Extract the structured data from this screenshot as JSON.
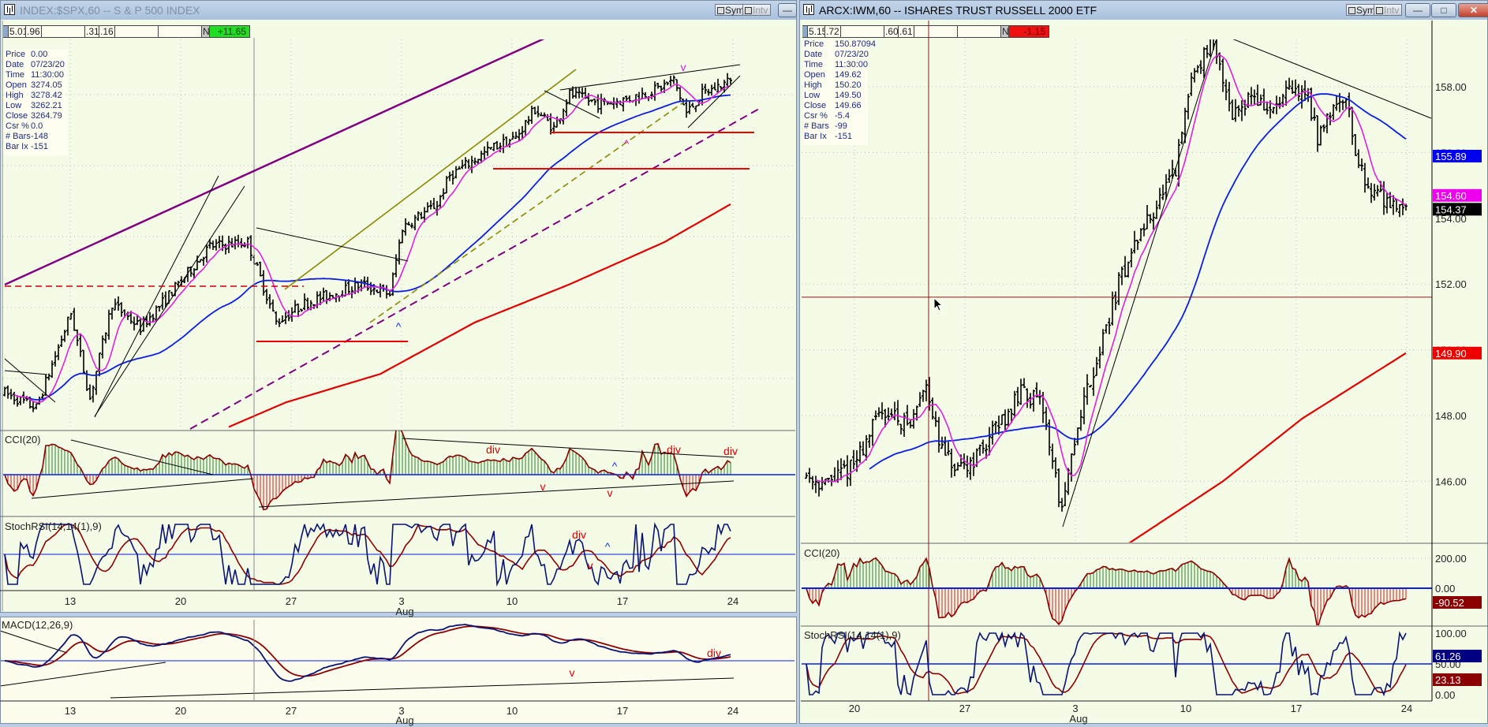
{
  "left_window": {
    "title": "INDEX:$SPX,60 -- S & P 500 INDEX",
    "sym_label": "Sym",
    "intv_label": "Intv",
    "minimize_glyph": "—",
    "header_cells": [
      "5.01",
      ".96",
      "",
      ".31",
      ".16",
      "",
      "",
      "N",
      "+11.65"
    ],
    "change_color": "#22dd22",
    "info": [
      {
        "label": "Price",
        "value": "0.00"
      },
      {
        "label": "Date",
        "value": "07/23/20"
      },
      {
        "label": "Time",
        "value": "11:30:00"
      },
      {
        "label": "Open",
        "value": "3274.05"
      },
      {
        "label": "High",
        "value": "3278.42"
      },
      {
        "label": "Low",
        "value": "3262.21"
      },
      {
        "label": "Close",
        "value": "3264.79"
      },
      {
        "label": "Csr %",
        "value": "0.0"
      },
      {
        "label": "# Bars",
        "value": "-148"
      },
      {
        "label": "Bar Ix",
        "value": "-151"
      }
    ],
    "cci_label": "CCI(20)",
    "stoch_label": "StochRSI(14,14(1),9)",
    "macd_label": "MACD(12,26,9)",
    "date_ticks": [
      "13",
      "20",
      "27",
      "3",
      "10",
      "17",
      "24"
    ],
    "month_label": "Aug",
    "annotations": {
      "price": [
        {
          "text": "v",
          "color": "#e020e0"
        },
        {
          "text": "^",
          "color": "#e020e0"
        },
        {
          "text": "^",
          "color": "#1030e0"
        }
      ],
      "cci": [
        {
          "text": "div",
          "color": "#e00000"
        },
        {
          "text": "div",
          "color": "#e00000"
        },
        {
          "text": "div",
          "color": "#e00000"
        },
        {
          "text": "v",
          "color": "#e00000"
        },
        {
          "text": "v",
          "color": "#e00000"
        },
        {
          "text": "^",
          "color": "#1030e0"
        }
      ],
      "stoch": [
        {
          "text": "div",
          "color": "#e00000"
        },
        {
          "text": "v",
          "color": "#e00000"
        },
        {
          "text": "^",
          "color": "#1030e0"
        }
      ],
      "macd": [
        {
          "text": "v",
          "color": "#e00000"
        },
        {
          "text": "div",
          "color": "#e00000"
        }
      ]
    }
  },
  "right_window": {
    "title": "ARCX:IWM,60 -- ISHARES TRUST RUSSELL 2000 ETF",
    "sym_label": "Sym",
    "intv_label": "Intv",
    "minimize_glyph": "—",
    "maximize_glyph": "□",
    "close_glyph": "✕",
    "header_cells": [
      "5.15",
      ".72",
      "",
      ".60",
      ".61",
      "",
      "",
      "N",
      "-1.15"
    ],
    "change_color": "#ee1111",
    "info": [
      {
        "label": "Price",
        "value": "150.87094"
      },
      {
        "label": "Date",
        "value": "07/23/20"
      },
      {
        "label": "Time",
        "value": "11:30:00"
      },
      {
        "label": "Open",
        "value": "149.62"
      },
      {
        "label": "High",
        "value": "150.20"
      },
      {
        "label": "Low",
        "value": "149.50"
      },
      {
        "label": "Close",
        "value": "149.66"
      },
      {
        "label": "Csr %",
        "value": "-5.4"
      },
      {
        "label": "# Bars",
        "value": "-99"
      },
      {
        "label": "Bar Ix",
        "value": "-151"
      }
    ],
    "price_axis": [
      "158.00",
      "156.00",
      "154.00",
      "152.00",
      "150.00",
      "148.00",
      "146.00"
    ],
    "price_tags": [
      {
        "value": "155.89",
        "color": "#0000ee"
      },
      {
        "value": "154.60",
        "color": "#ee00ee"
      },
      {
        "value": "154.37",
        "color": "#000000"
      },
      {
        "value": "149.90",
        "color": "#ee0000"
      }
    ],
    "cci_label": "CCI(20)",
    "cci_axis": [
      "200.00",
      "0.00"
    ],
    "cci_tag": {
      "value": "-90.52",
      "color": "#8b0000"
    },
    "stoch_label": "StochRSI(14,14(1),9)",
    "stoch_axis": [
      "100.00",
      "50.00",
      "0.00"
    ],
    "stoch_tags": [
      {
        "value": "61.26",
        "color": "#000080"
      },
      {
        "value": "23.13",
        "color": "#8b0000"
      }
    ],
    "date_ticks": [
      "20",
      "27",
      "3",
      "10",
      "17",
      "24"
    ],
    "month_label": "Aug"
  },
  "chart_data": [
    {
      "type": "ohlc",
      "title": "INDEX:$SPX,60 -- S & P 500 INDEX",
      "x_unit": "hourly bar index",
      "ylim": [
        3150,
        3450
      ],
      "price_keypoints": [
        [
          0,
          3177
        ],
        [
          10,
          3166
        ],
        [
          21,
          3236
        ],
        [
          27,
          3173
        ],
        [
          34,
          3243
        ],
        [
          43,
          3225
        ],
        [
          55,
          3257
        ],
        [
          65,
          3285
        ],
        [
          77,
          3288
        ],
        [
          86,
          3229
        ],
        [
          95,
          3243
        ],
        [
          113,
          3257
        ],
        [
          122,
          3250
        ],
        [
          126,
          3299
        ],
        [
          137,
          3316
        ],
        [
          141,
          3337
        ],
        [
          155,
          3358
        ],
        [
          162,
          3365
        ],
        [
          168,
          3386
        ],
        [
          174,
          3372
        ],
        [
          179,
          3397
        ],
        [
          188,
          3390
        ],
        [
          197,
          3393
        ],
        [
          206,
          3400
        ],
        [
          212,
          3407
        ],
        [
          216,
          3383
        ],
        [
          221,
          3397
        ],
        [
          230,
          3407
        ]
      ],
      "ma_long_keypoints": [
        [
          71,
          3152
        ],
        [
          89,
          3170
        ],
        [
          119,
          3191
        ],
        [
          149,
          3229
        ],
        [
          179,
          3257
        ],
        [
          209,
          3288
        ],
        [
          230,
          3316
        ]
      ],
      "support_levels": [
        3226,
        3380,
        3407
      ],
      "resistance_dashed": 3261,
      "indicators": [
        "CCI(20)",
        "StochRSI(14,14(1),9)",
        "MACD(12,26,9)"
      ]
    },
    {
      "type": "ohlc",
      "title": "ARCX:IWM,60 -- ISHARES TRUST RUSSELL 2000 ETF",
      "x_unit": "hourly bar index",
      "ylim": [
        144.5,
        159.9
      ],
      "price_keypoints": [
        [
          0,
          146.2
        ],
        [
          6,
          145.9
        ],
        [
          15,
          146.5
        ],
        [
          24,
          148.2
        ],
        [
          33,
          147.7
        ],
        [
          38,
          149.1
        ],
        [
          42,
          147.1
        ],
        [
          48,
          146.2
        ],
        [
          54,
          146.8
        ],
        [
          63,
          148.0
        ],
        [
          69,
          148.8
        ],
        [
          75,
          148.2
        ],
        [
          81,
          145.05
        ],
        [
          87,
          148.2
        ],
        [
          93,
          150.0
        ],
        [
          99,
          152.0
        ],
        [
          105,
          153.4
        ],
        [
          117,
          155.4
        ],
        [
          122,
          158.3
        ],
        [
          128,
          159.3
        ],
        [
          132,
          158.3
        ],
        [
          135,
          157.2
        ],
        [
          141,
          157.8
        ],
        [
          147,
          157.2
        ],
        [
          153,
          157.8
        ],
        [
          159,
          157.8
        ],
        [
          162,
          156.3
        ],
        [
          165,
          157.2
        ],
        [
          171,
          157.8
        ],
        [
          174,
          156.0
        ],
        [
          177,
          155.1
        ],
        [
          183,
          154.6
        ],
        [
          190,
          154.37
        ]
      ],
      "ma_long_keypoints": [
        [
          102,
          144.1
        ],
        [
          132,
          146.0
        ],
        [
          157,
          147.9
        ],
        [
          190,
          149.9
        ]
      ],
      "crosshair_price": 151.6,
      "last_values": {
        "close": 154.37,
        "ma_fast": 154.6,
        "ma_mid": 155.89,
        "ma_long": 149.9,
        "cci": -90.52,
        "stoch_k": 61.26,
        "stoch_d": 23.13
      }
    }
  ]
}
